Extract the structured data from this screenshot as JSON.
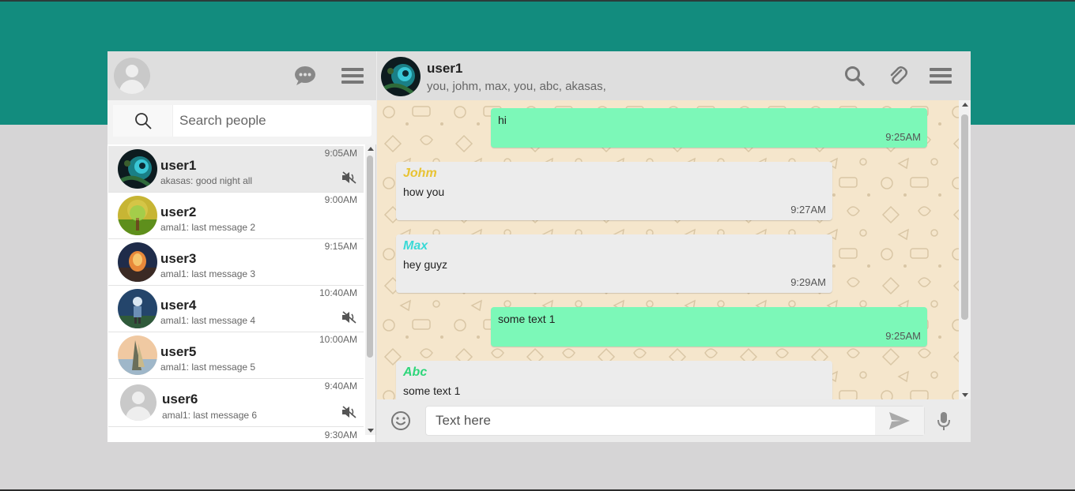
{
  "colors": {
    "header_band": "#128c7e",
    "outgoing_bubble": "#7cf8b8",
    "incoming_bubble": "#ececec",
    "chat_background": "#f5e6cc"
  },
  "sidebar": {
    "header": {
      "avatar_icon": "user-avatar",
      "chat_icon": "chat-bubble-icon",
      "menu_icon": "hamburger-menu-icon"
    },
    "search": {
      "placeholder": "Search people",
      "icon": "search-icon"
    },
    "contacts": [
      {
        "name": "user1",
        "last_message": "akasas: good night all",
        "time": "9:05AM",
        "muted": true,
        "active": true
      },
      {
        "name": "user2",
        "last_message": "amal1: last message 2",
        "time": "9:00AM",
        "muted": false,
        "active": false
      },
      {
        "name": "user3",
        "last_message": "amal1: last message 3",
        "time": "9:15AM",
        "muted": false,
        "active": false
      },
      {
        "name": "user4",
        "last_message": "amal1: last message 4",
        "time": "10:40AM",
        "muted": true,
        "active": false
      },
      {
        "name": "user5",
        "last_message": "amal1: last message 5",
        "time": "10:00AM",
        "muted": false,
        "active": false
      },
      {
        "name": "user6",
        "last_message": "amal1: last message 6",
        "time": "9:40AM",
        "muted": true,
        "active": false
      },
      {
        "name": "",
        "last_message": "",
        "time": "9:30AM",
        "muted": false,
        "active": false
      }
    ]
  },
  "chat": {
    "title": "user1",
    "members": "you, johm, max, you, abc, akasas,",
    "messages": [
      {
        "direction": "out",
        "sender": "",
        "text": "hi",
        "time": "9:25AM"
      },
      {
        "direction": "in",
        "sender": "Johm",
        "sender_color": "#e8c334",
        "text": "how you",
        "time": "9:27AM"
      },
      {
        "direction": "in",
        "sender": "Max",
        "sender_color": "#39d9d6",
        "text": "hey guyz",
        "time": "9:29AM"
      },
      {
        "direction": "out",
        "sender": "",
        "text": "some text 1",
        "time": "9:25AM"
      },
      {
        "direction": "in",
        "sender": "Abc",
        "sender_color": "#2ed67a",
        "text": "some text 1",
        "time": ""
      }
    ],
    "composer": {
      "placeholder": "Text here",
      "emoji_icon": "emoji-icon",
      "send_icon": "send-icon",
      "mic_icon": "microphone-icon"
    }
  }
}
